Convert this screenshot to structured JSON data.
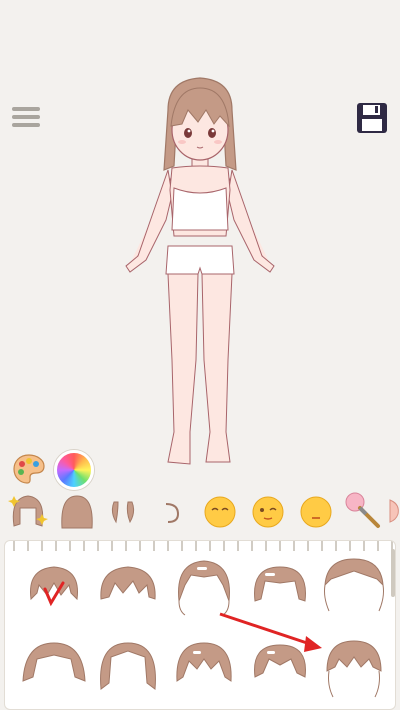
{
  "toolbar": {
    "menu_icon": "hamburger-menu-icon",
    "save_icon": "floppy-disk-save-icon"
  },
  "tools": {
    "palette_icon": "paint-palette-icon",
    "color_wheel_icon": "color-wheel-icon"
  },
  "categories": [
    {
      "name": "hair",
      "icon": "hair-icon",
      "selected": true
    },
    {
      "name": "back-hair",
      "icon": "back-hair-icon"
    },
    {
      "name": "eyebrows",
      "icon": "eyebrows-icon"
    },
    {
      "name": "ears",
      "icon": "ear-icon"
    },
    {
      "name": "eyes",
      "icon": "closed-eyes-face-icon"
    },
    {
      "name": "wink",
      "icon": "wink-face-icon"
    },
    {
      "name": "mouth",
      "icon": "neutral-face-icon"
    },
    {
      "name": "makeup",
      "icon": "makeup-brush-icon"
    },
    {
      "name": "more",
      "icon": "hand-icon"
    }
  ],
  "hair_options": [
    {
      "style": "bangs-short",
      "selected": true
    },
    {
      "style": "bob-wavy"
    },
    {
      "style": "clip-long"
    },
    {
      "style": "clip-medium"
    },
    {
      "style": "long-side-part"
    },
    {
      "style": "pigtails"
    },
    {
      "style": "swept-long"
    },
    {
      "style": "mid-flip"
    },
    {
      "style": "straight-bangs"
    },
    {
      "style": "long-straight-bangs"
    }
  ],
  "colors": {
    "background": "#f3f1ee",
    "hair": "#c49a86",
    "hair_dark": "#a07866",
    "skin": "#fde7e1",
    "outline": "#a8646a",
    "accent_red": "#e02424"
  }
}
